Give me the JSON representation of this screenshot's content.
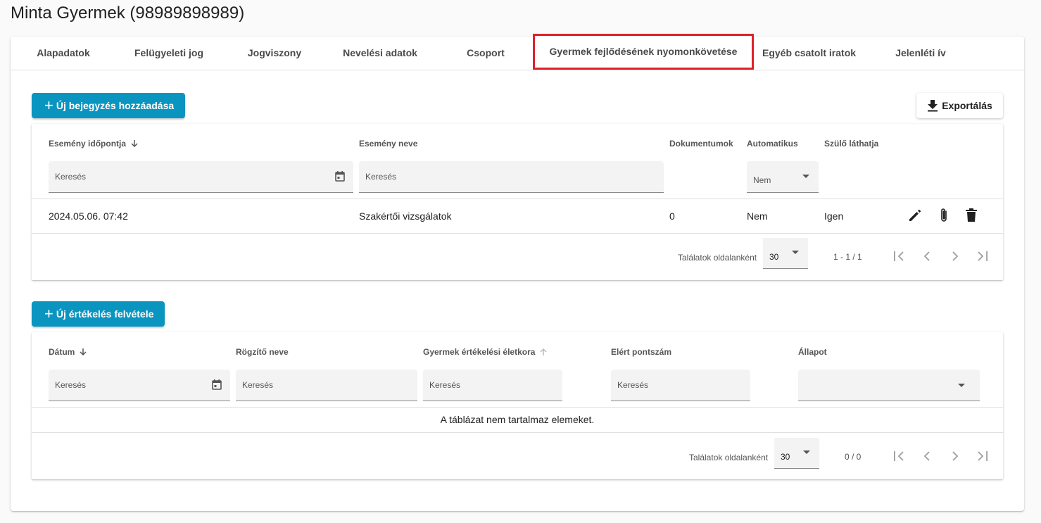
{
  "page": {
    "title": "Minta Gyermek (98989898989)"
  },
  "tabs": [
    {
      "label": "Alapadatok"
    },
    {
      "label": "Felügyeleti jog"
    },
    {
      "label": "Jogviszony"
    },
    {
      "label": "Nevelési adatok"
    },
    {
      "label": "Csoport"
    },
    {
      "label": "Gyermek fejlődésének nyomonkövetése",
      "active": true
    },
    {
      "label": "Egyéb csatolt iratok"
    },
    {
      "label": "Jelenléti ív"
    }
  ],
  "events": {
    "add_button": "Új bejegyzés hozzáadása",
    "export_button": "Exportálás",
    "columns": {
      "date": "Esemény időpontja",
      "name": "Esemény neve",
      "documents": "Dokumentumok",
      "automatic": "Automatikus",
      "parent_visible": "Szülő láthatja"
    },
    "filters": {
      "date_placeholder": "Keresés",
      "name_placeholder": "Keresés",
      "automatic_value": "Nem"
    },
    "rows": [
      {
        "date": "2024.05.06. 07:42",
        "name": "Szakértői vizsgálatok",
        "documents": "0",
        "automatic": "Nem",
        "parent_visible": "Igen"
      }
    ],
    "paginator": {
      "label": "Találatok oldalanként",
      "page_size": "30",
      "range": "1 - 1 / 1"
    }
  },
  "evaluations": {
    "add_button": "Új értékelés felvétele",
    "columns": {
      "date": "Dátum",
      "recorder": "Rögzítő neve",
      "age": "Gyermek értékelési életkora",
      "score": "Elért pontszám",
      "status": "Állapot"
    },
    "filters": {
      "date_placeholder": "Keresés",
      "recorder_placeholder": "Keresés",
      "age_placeholder": "Keresés",
      "score_placeholder": "Keresés",
      "status_value": ""
    },
    "empty_message": "A táblázat nem tartalmaz elemeket.",
    "paginator": {
      "label": "Találatok oldalanként",
      "page_size": "30",
      "range": "0 / 0"
    }
  },
  "colors": {
    "primary": "#0a95c0",
    "highlight": "#e0202a"
  },
  "icons": [
    "plus-icon",
    "download-icon",
    "arrow-down-icon",
    "arrow-up-icon",
    "calendar-icon",
    "edit-icon",
    "attach-icon",
    "delete-icon",
    "first-page-icon",
    "prev-page-icon",
    "next-page-icon",
    "last-page-icon",
    "caret-down-icon"
  ]
}
